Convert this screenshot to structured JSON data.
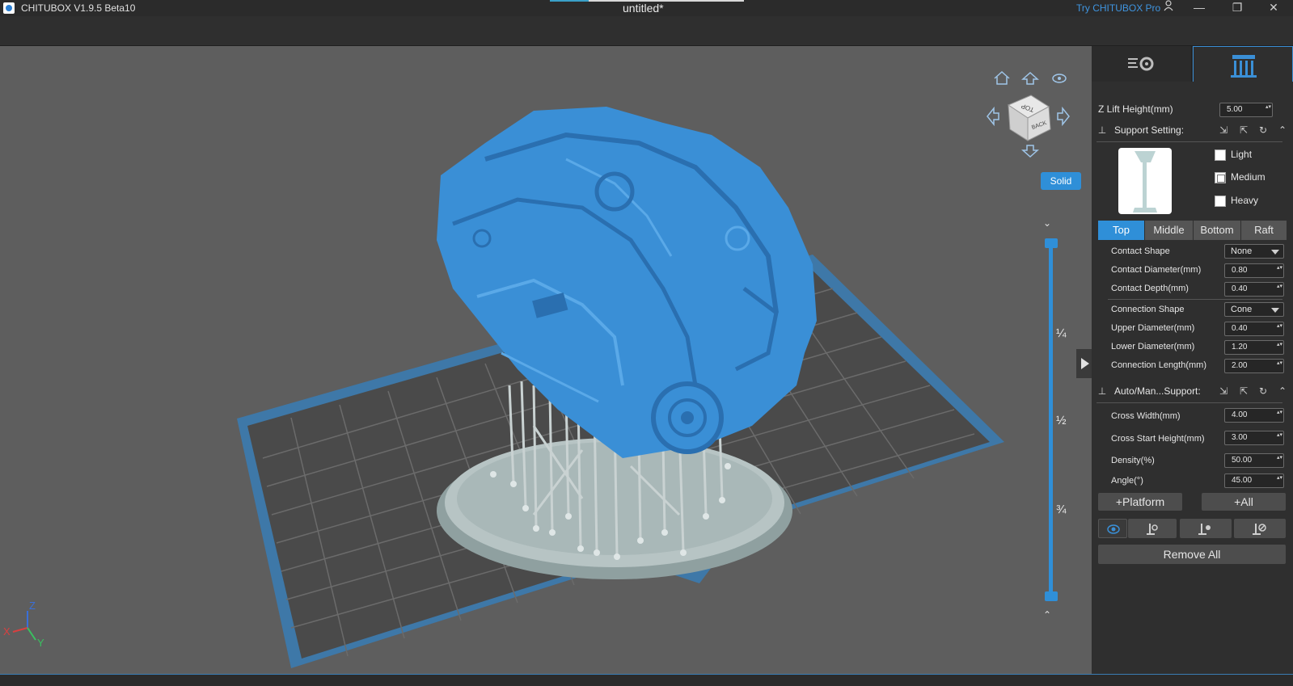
{
  "titlebar": {
    "app_title": "CHITUBOX V1.9.5 Beta10",
    "document_title": "untitled*",
    "try_pro": "Try CHITUBOX Pro"
  },
  "viewport": {
    "view_mode_button": "Solid",
    "nav_cube_top": "TOP",
    "nav_cube_back": "BACK",
    "slider_marks": [
      "¼",
      "½",
      "¾"
    ],
    "axis_labels": {
      "x": "X",
      "y": "Y",
      "z": "Z"
    }
  },
  "panel": {
    "tabs": [
      {
        "label": "settings",
        "icon": "print-settings-icon"
      },
      {
        "label": "supports",
        "icon": "supports-icon"
      }
    ],
    "z_lift": {
      "label": "Z Lift Height(mm)",
      "value": "5.00"
    },
    "support_setting": {
      "title": "Support Setting:",
      "presets": [
        {
          "label": "Light",
          "checked": false
        },
        {
          "label": "Medium",
          "checked": false
        },
        {
          "label": "Heavy",
          "checked": false
        }
      ],
      "segments": [
        "Top",
        "Middle",
        "Bottom",
        "Raft"
      ],
      "active_segment": "Top",
      "contact_shape": {
        "label": "Contact Shape",
        "value": "None"
      },
      "contact_diameter": {
        "label": "Contact Diameter(mm)",
        "value": "0.80"
      },
      "contact_depth": {
        "label": "Contact Depth(mm)",
        "value": "0.40"
      },
      "connection_shape": {
        "label": "Connection Shape",
        "value": "Cone"
      },
      "upper_diameter": {
        "label": "Upper Diameter(mm)",
        "value": "0.40"
      },
      "lower_diameter": {
        "label": "Lower Diameter(mm)",
        "value": "1.20"
      },
      "connection_length": {
        "label": "Connection Length(mm)",
        "value": "2.00"
      }
    },
    "auto_manual": {
      "title": "Auto/Man...Support:",
      "cross_width": {
        "label": "Cross Width(mm)",
        "value": "4.00"
      },
      "cross_start_height": {
        "label": "Cross Start Height(mm)",
        "value": "3.00"
      },
      "density": {
        "label": "Density(%)",
        "value": "50.00"
      },
      "angle": {
        "label": "Angle(°)",
        "value": "45.00"
      }
    },
    "platform_button": "+Platform",
    "all_button": "+All",
    "remove_all_button": "Remove All"
  },
  "colors": {
    "accent": "#2f8fd8",
    "model": "#3a8fd6",
    "support": "#a9b8b8",
    "viewport_bg": "#5e5e5e"
  }
}
